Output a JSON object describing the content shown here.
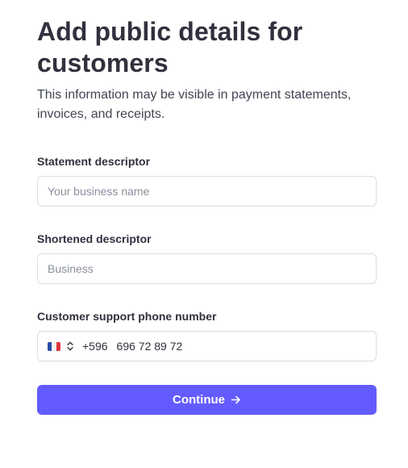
{
  "header": {
    "title": "Add public details for customers",
    "subtitle": "This information may be visible in payment statements, invoices, and receipts."
  },
  "fields": {
    "statement_descriptor": {
      "label": "Statement descriptor",
      "placeholder": "Your business name",
      "value": ""
    },
    "shortened_descriptor": {
      "label": "Shortened descriptor",
      "placeholder": "Business",
      "value": ""
    },
    "support_phone": {
      "label": "Customer support phone number",
      "country_flag": "france-flag-icon",
      "dial_code": "+596",
      "value": "696 72 89 72"
    }
  },
  "actions": {
    "continue_label": "Continue",
    "continue_icon": "arrow-right-icon"
  },
  "colors": {
    "accent": "#635bff",
    "text": "#30313d",
    "border": "#dcdde1",
    "placeholder": "#8a8f9c"
  }
}
